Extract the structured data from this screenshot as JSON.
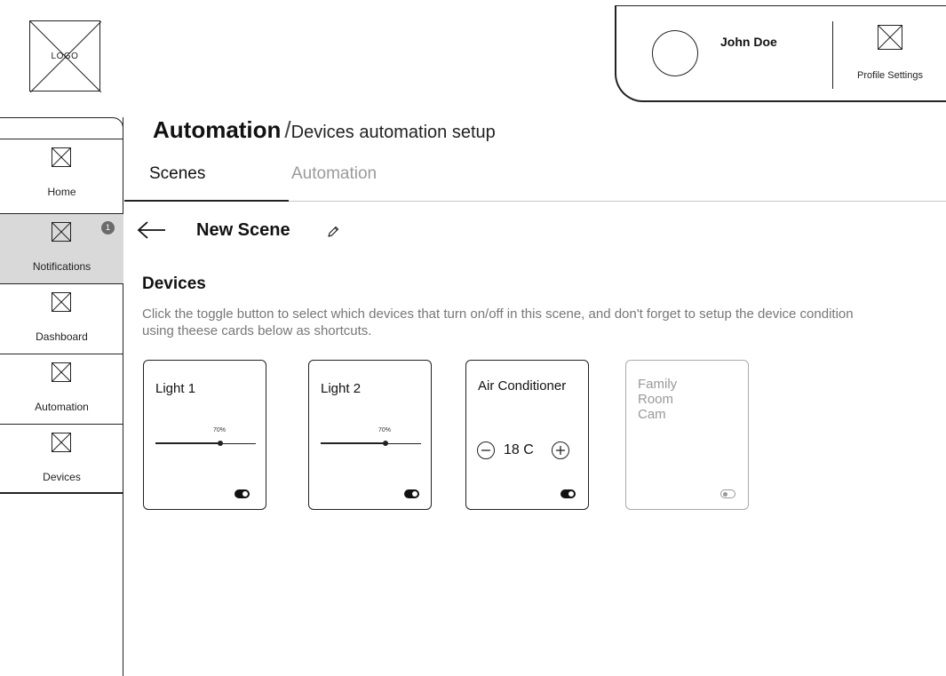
{
  "logo": {
    "text": "LOGO"
  },
  "profile": {
    "name": "John Doe",
    "settings_label": "Profile Settings"
  },
  "sidebar": {
    "items": [
      {
        "label": "Home",
        "icon": "image-placeholder-icon",
        "active": false
      },
      {
        "label": "Notifications",
        "icon": "image-placeholder-icon",
        "active": true,
        "badge": "1"
      },
      {
        "label": "Dashboard",
        "icon": "image-placeholder-icon",
        "active": false
      },
      {
        "label": "Automation",
        "icon": "image-placeholder-icon",
        "active": false
      },
      {
        "label": "Devices",
        "icon": "image-placeholder-icon",
        "active": false
      }
    ]
  },
  "page": {
    "title": "Automation",
    "separator": "/",
    "subtitle": "Devices automation setup"
  },
  "tabs": [
    {
      "label": "Scenes",
      "active": true
    },
    {
      "label": "Automation",
      "active": false
    }
  ],
  "scene": {
    "name": "New Scene",
    "back_icon": "arrow-left-icon",
    "edit_icon": "pencil-icon"
  },
  "devices": {
    "title": "Devices",
    "description": "Click the toggle button to select which devices that turn on/off in this scene, and don't forget to setup the device condition using theese cards below as shortcuts.",
    "cards": [
      {
        "name": "Light 1",
        "type": "light",
        "brightness_label": "70%",
        "brightness": 0.65,
        "enabled": true
      },
      {
        "name": "Light 2",
        "type": "light",
        "brightness_label": "70%",
        "brightness": 0.65,
        "enabled": true
      },
      {
        "name": "Air Conditioner",
        "type": "ac",
        "temperature": "18 C",
        "enabled": true
      },
      {
        "name": "Family Room Cam",
        "type": "camera",
        "enabled": false
      }
    ]
  },
  "colors": {
    "active_nav_bg": "#d9d9d9",
    "badge_bg": "#6b6b6b",
    "inactive_tab": "#9a9a9a",
    "description_text": "#777777"
  }
}
